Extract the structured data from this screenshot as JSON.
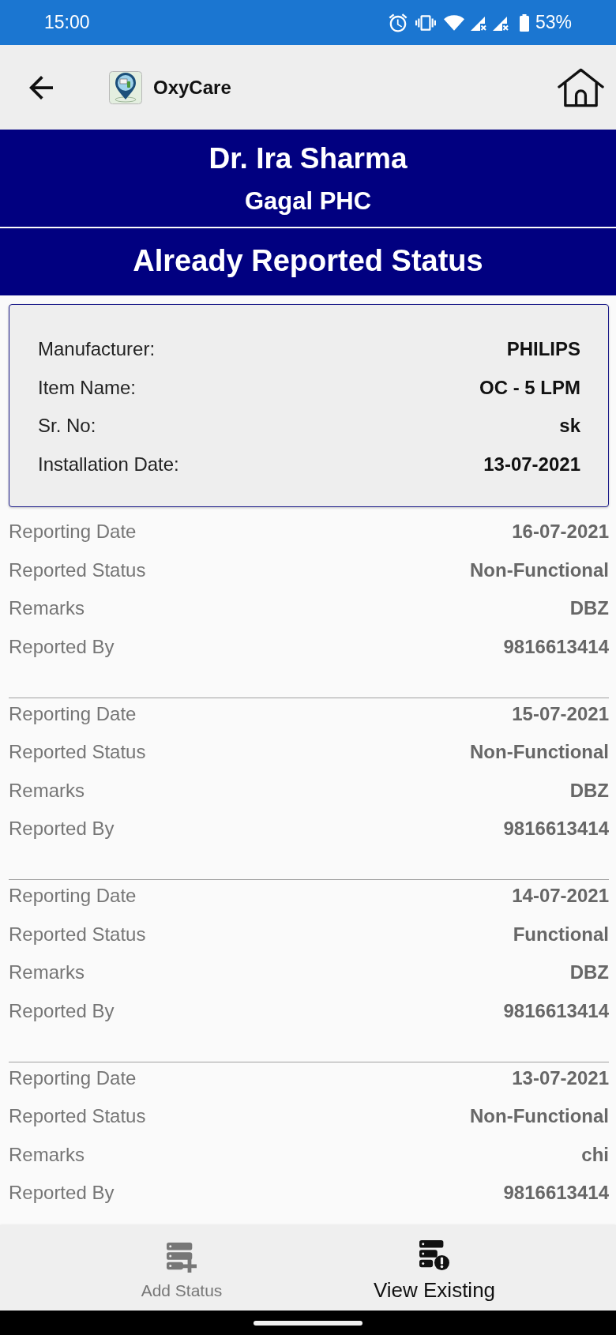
{
  "status_bar": {
    "time": "15:00",
    "battery": "53%"
  },
  "app_bar": {
    "title": "OxyCare"
  },
  "header": {
    "name": "Dr. Ira Sharma",
    "facility": "Gagal PHC"
  },
  "section_title": "Already Reported Status",
  "device": {
    "fields": [
      {
        "label": "Manufacturer:",
        "value": "PHILIPS"
      },
      {
        "label": "Item Name:",
        "value": "OC - 5 LPM"
      },
      {
        "label": "Sr. No:",
        "value": "sk"
      },
      {
        "label": "Installation Date:",
        "value": "13-07-2021"
      }
    ]
  },
  "reports": [
    {
      "fields": [
        {
          "label": "Reporting Date",
          "value": "16-07-2021"
        },
        {
          "label": "Reported Status",
          "value": "Non-Functional"
        },
        {
          "label": "Remarks",
          "value": "DBZ"
        },
        {
          "label": "Reported By",
          "value": "9816613414"
        }
      ]
    },
    {
      "fields": [
        {
          "label": "Reporting Date",
          "value": "15-07-2021"
        },
        {
          "label": "Reported Status",
          "value": "Non-Functional"
        },
        {
          "label": "Remarks",
          "value": "DBZ"
        },
        {
          "label": "Reported By",
          "value": "9816613414"
        }
      ]
    },
    {
      "fields": [
        {
          "label": "Reporting Date",
          "value": "14-07-2021"
        },
        {
          "label": "Reported Status",
          "value": "Functional"
        },
        {
          "label": "Remarks",
          "value": "DBZ"
        },
        {
          "label": "Reported By",
          "value": "9816613414"
        }
      ]
    },
    {
      "fields": [
        {
          "label": "Reporting Date",
          "value": "13-07-2021"
        },
        {
          "label": "Reported Status",
          "value": "Non-Functional"
        },
        {
          "label": "Remarks",
          "value": "chi"
        },
        {
          "label": "Reported By",
          "value": "9816613414"
        }
      ]
    }
  ],
  "bottom_nav": [
    {
      "kind": "add",
      "label": "Add Status",
      "selected": false
    },
    {
      "kind": "view",
      "label": "View Existing",
      "selected": true
    }
  ]
}
